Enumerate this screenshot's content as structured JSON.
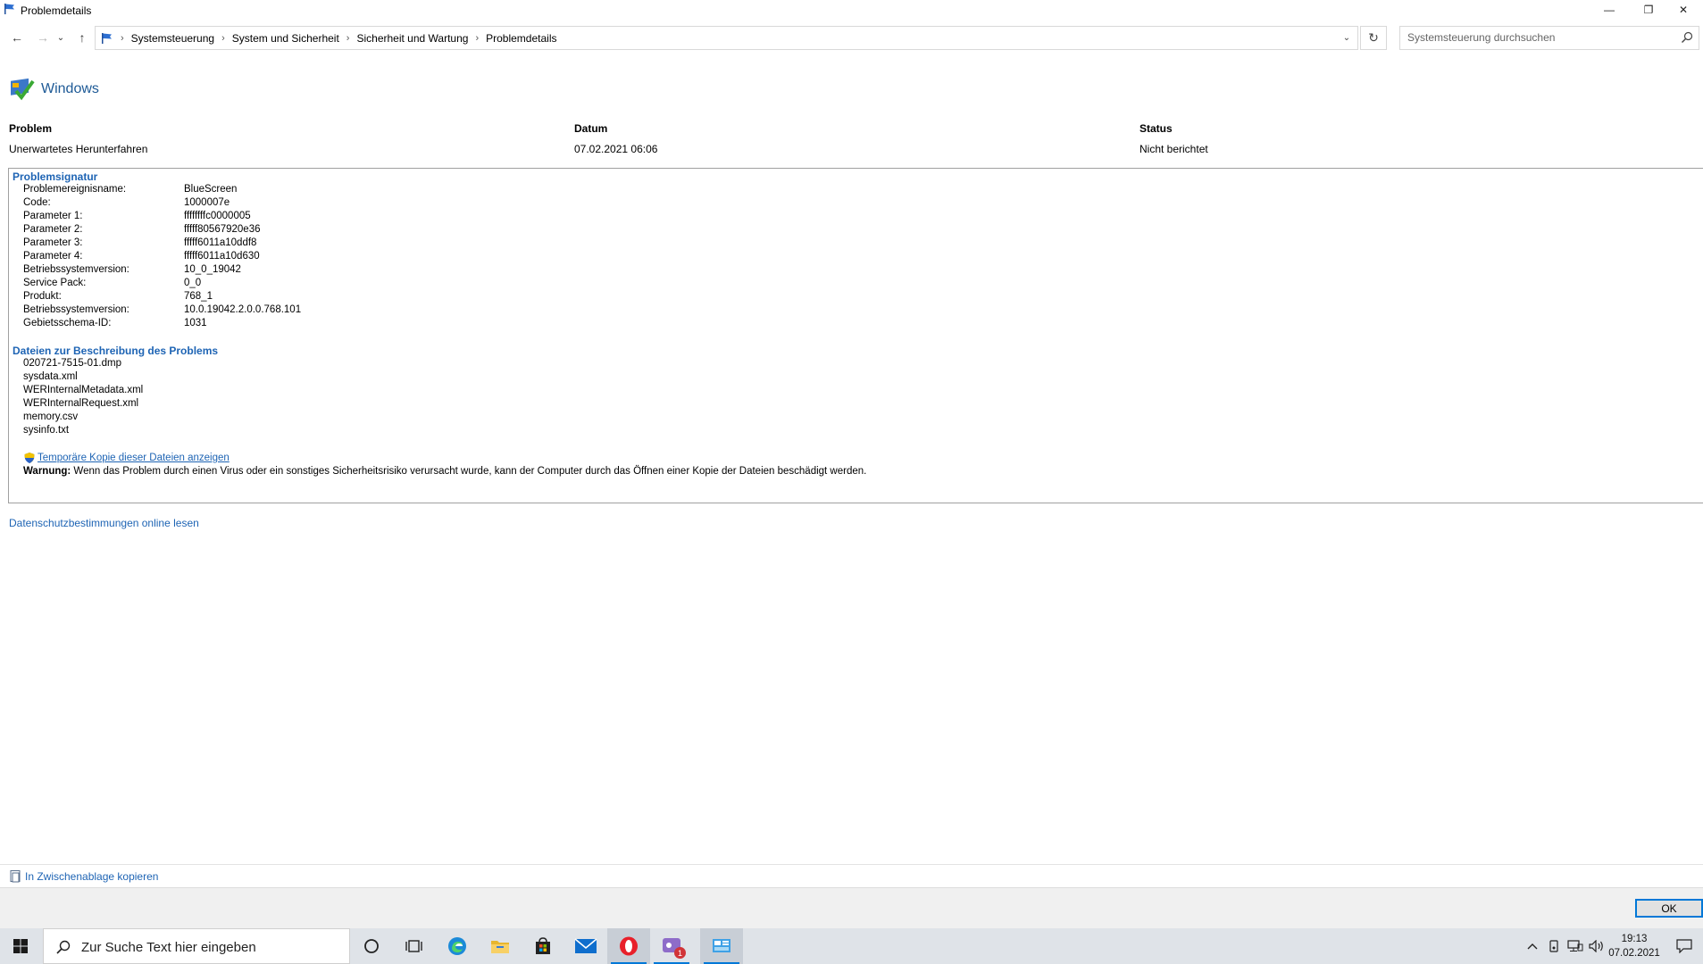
{
  "window": {
    "title": "Problemdetails",
    "minimize": "—",
    "restore": "❐",
    "close": "✕"
  },
  "nav": {
    "back": "←",
    "forward": "→",
    "recent": "⌄",
    "up": "↑",
    "breadcrumbs": [
      "Systemsteuerung",
      "System und Sicherheit",
      "Sicherheit und Wartung",
      "Problemdetails"
    ],
    "breadcrumb_sep": "›",
    "dropdown": "⌄",
    "refresh": "↻",
    "search_placeholder": "Systemsteuerung durchsuchen"
  },
  "app": {
    "source_label": "Windows"
  },
  "summary": {
    "headers": [
      "Problem",
      "Datum",
      "Status"
    ],
    "values": [
      "Unerwartetes Herunterfahren",
      "07.02.2021 06:06",
      "Nicht berichtet"
    ]
  },
  "signature": {
    "title": "Problemsignatur",
    "rows": [
      {
        "key": "Problemereignisname:",
        "value": "BlueScreen"
      },
      {
        "key": "Code:",
        "value": "1000007e"
      },
      {
        "key": "Parameter 1:",
        "value": "ffffffffc0000005"
      },
      {
        "key": "Parameter 2:",
        "value": "fffff80567920e36"
      },
      {
        "key": "Parameter 3:",
        "value": "fffff6011a10ddf8"
      },
      {
        "key": "Parameter 4:",
        "value": "fffff6011a10d630"
      },
      {
        "key": "Betriebssystemversion:",
        "value": "10_0_19042"
      },
      {
        "key": "Service Pack:",
        "value": "0_0"
      },
      {
        "key": "Produkt:",
        "value": "768_1"
      },
      {
        "key": "Betriebssystemversion:",
        "value": "10.0.19042.2.0.0.768.101"
      },
      {
        "key": "Gebietsschema-ID:",
        "value": "1031"
      }
    ]
  },
  "files": {
    "title": "Dateien zur Beschreibung des Problems",
    "items": [
      "020721-7515-01.dmp",
      "sysdata.xml",
      "WERInternalMetadata.xml",
      "WERInternalRequest.xml",
      "memory.csv",
      "sysinfo.txt"
    ]
  },
  "temp_link": "Temporäre Kopie dieser Dateien anzeigen",
  "warning": {
    "label": "Warnung:",
    "text": " Wenn das Problem durch einen Virus oder ein sonstiges Sicherheitsrisiko verursacht wurde, kann der Computer durch das Öffnen einer Kopie der Dateien beschädigt werden."
  },
  "privacy_link": "Datenschutzbestimmungen online lesen",
  "copy_link": "In Zwischenablage kopieren",
  "ok_button": "OK",
  "taskbar": {
    "search_placeholder": "Zur Suche Text hier eingeben",
    "time": "19:13",
    "date": "07.02.2021",
    "badge": "1"
  },
  "colors": {
    "link": "#1e64b4",
    "accent": "#0078d7",
    "taskbar": "#dfe3e8"
  }
}
